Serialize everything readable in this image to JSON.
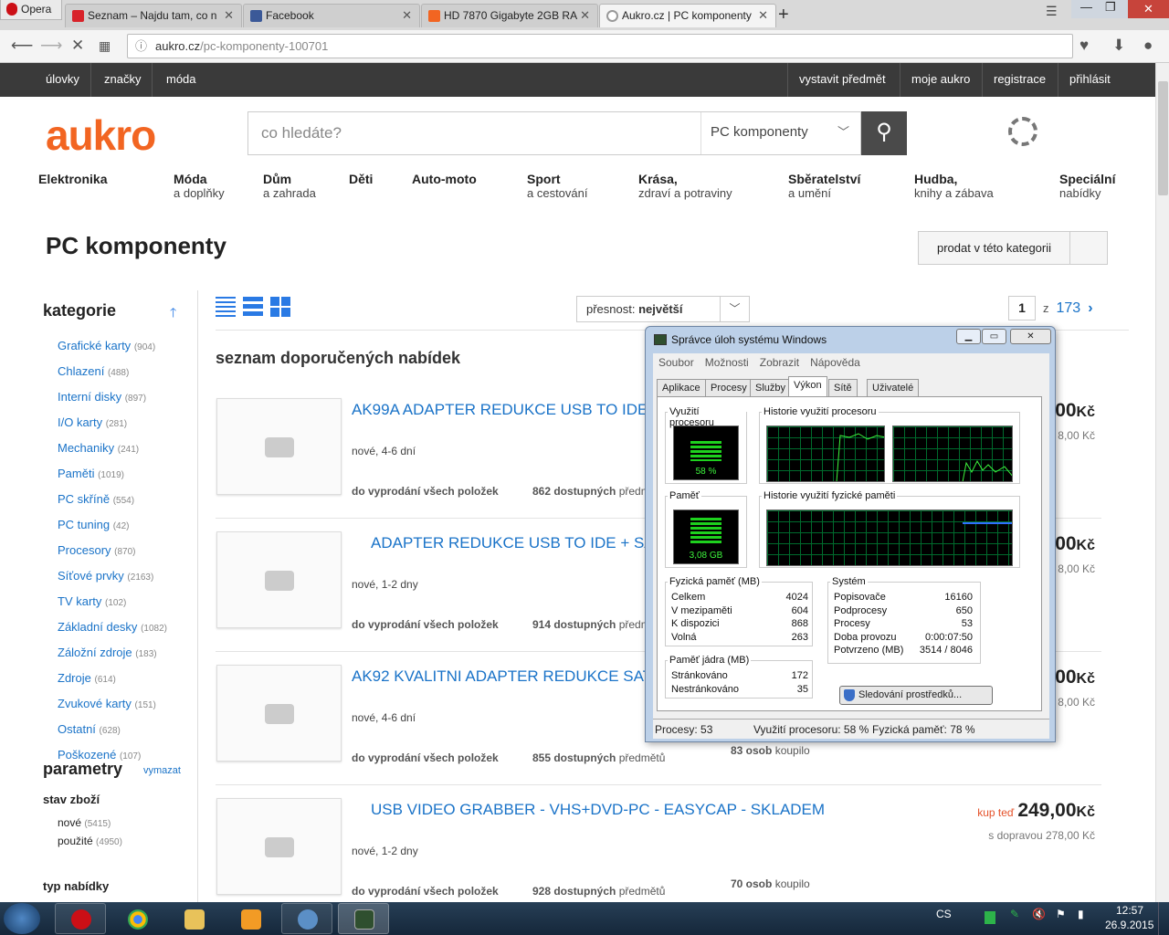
{
  "browser": {
    "menu_label": "Opera",
    "tabs": [
      {
        "label": "Seznam – Najdu tam, co n",
        "color": "#d8232a"
      },
      {
        "label": "Facebook",
        "color": "#3b5998"
      },
      {
        "label": "HD 7870 Gigabyte 2GB RA",
        "color": "#f26522"
      },
      {
        "label": "Aukro.cz | PC komponenty",
        "color": "#999999"
      }
    ],
    "url_host": "aukro.cz",
    "url_path": "/pc-komponenty-100701"
  },
  "site": {
    "topnav_left": [
      "úlovky",
      "značky",
      "móda"
    ],
    "topnav_right": [
      "vystavit předmět",
      "moje aukro",
      "registrace",
      "přihlásit"
    ],
    "logo": "aukro",
    "search_placeholder": "co hledáte?",
    "search_category": "PC komponenty",
    "categories": [
      {
        "main": "Elektronika",
        "sub": ""
      },
      {
        "main": "Móda",
        "sub": "a doplňky"
      },
      {
        "main": "Dům",
        "sub": "a zahrada"
      },
      {
        "main": "Děti",
        "sub": ""
      },
      {
        "main": "Auto-moto",
        "sub": ""
      },
      {
        "main": "Sport",
        "sub": "a cestování"
      },
      {
        "main": "Krása,",
        "sub": "zdraví a potraviny"
      },
      {
        "main": "Sběratelství",
        "sub": "a umění"
      },
      {
        "main": "Hudba,",
        "sub": "knihy a zábava"
      },
      {
        "main": "Speciální",
        "sub": "nabídky"
      }
    ],
    "page_title": "PC komponenty",
    "sell_button": "prodat v této kategorii"
  },
  "sidebar": {
    "heading": "kategorie",
    "items": [
      {
        "label": "Grafické karty",
        "count": "(904)"
      },
      {
        "label": "Chlazení",
        "count": "(488)"
      },
      {
        "label": "Interní disky",
        "count": "(897)"
      },
      {
        "label": "I/O karty",
        "count": "(281)"
      },
      {
        "label": "Mechaniky",
        "count": "(241)"
      },
      {
        "label": "Paměti",
        "count": "(1019)"
      },
      {
        "label": "PC skříně",
        "count": "(554)"
      },
      {
        "label": "PC tuning",
        "count": "(42)"
      },
      {
        "label": "Procesory",
        "count": "(870)"
      },
      {
        "label": "Síťové prvky",
        "count": "(2163)"
      },
      {
        "label": "TV karty",
        "count": "(102)"
      },
      {
        "label": "Základní desky",
        "count": "(1082)"
      },
      {
        "label": "Záložní zdroje",
        "count": "(183)"
      },
      {
        "label": "Zdroje",
        "count": "(614)"
      },
      {
        "label": "Zvukové karty",
        "count": "(151)"
      },
      {
        "label": "Ostatní",
        "count": "(628)"
      },
      {
        "label": "Poškozené",
        "count": "(107)"
      }
    ],
    "params_heading": "parametry",
    "params_clear": "vymazat",
    "state_heading": "stav zboží",
    "states": [
      {
        "label": "nové",
        "count": "(5415)"
      },
      {
        "label": "použité",
        "count": "(4950)"
      }
    ],
    "offer_type_heading": "typ nabídky"
  },
  "listing": {
    "sort_label": "přesnost:",
    "sort_value": "největší",
    "page": "1",
    "page_of": "z",
    "total_pages": "173",
    "heading": "seznam doporučených nabídek",
    "items": [
      {
        "title": "AK99A ADAPTER REDUKCE USB TO IDE +",
        "cond": "nové, 4-6 dní",
        "foot": "do vyprodání všech položek",
        "avail_n": "862 dostupných",
        "avail_t": "předm",
        "bought_n": "",
        "bought_t": "",
        "price": "00",
        "kc": "Kč",
        "ship": "8,00 Kč",
        "kup": ""
      },
      {
        "title": "ADAPTER REDUKCE USB TO IDE + SAT",
        "cond": "nové, 1-2 dny",
        "foot": "do vyprodání všech položek",
        "avail_n": "914 dostupných",
        "avail_t": "předm",
        "bought_n": "",
        "bought_t": "",
        "price": "00",
        "kc": "Kč",
        "ship": "8,00 Kč",
        "kup": ""
      },
      {
        "title": "AK92 KVALITNI ADAPTER REDUKCE SATA",
        "cond": "nové, 4-6 dní",
        "foot": "do vyprodání všech položek",
        "avail_n": "855 dostupných",
        "avail_t": "předmětů",
        "bought_n": "83 osob",
        "bought_t": "koupilo",
        "price": "00",
        "kc": "Kč",
        "ship": "8,00 Kč",
        "kup": ""
      },
      {
        "title": "USB VIDEO GRABBER - VHS+DVD-PC - EASYCAP - SKLADEM",
        "cond": "nové, 1-2 dny",
        "foot": "do vyprodání všech položek",
        "avail_n": "928 dostupných",
        "avail_t": "předmětů",
        "bought_n": "70 osob",
        "bought_t": "koupilo",
        "price": "249,00",
        "kc": "Kč",
        "ship": "s dopravou 278,00 Kč",
        "kup": "kup teď"
      }
    ]
  },
  "taskmanager": {
    "title": "Správce úloh systému Windows",
    "menu": [
      "Soubor",
      "Možnosti",
      "Zobrazit",
      "Nápověda"
    ],
    "tabs": [
      "Aplikace",
      "Procesy",
      "Služby",
      "Výkon",
      "Sítě",
      "Uživatelé"
    ],
    "cpu_label": "Využití procesoru",
    "cpu_value": "58 %",
    "cpu_fraction": 0.58,
    "cpu_history_label": "Historie využití procesoru",
    "mem_label": "Paměť",
    "mem_value": "3,08 GB",
    "mem_fraction": 0.78,
    "mem_history_label": "Historie využití fyzické paměti",
    "phys_heading": "Fyzická paměť (MB)",
    "phys": [
      {
        "k": "Celkem",
        "v": "4024"
      },
      {
        "k": "V mezipaměti",
        "v": "604"
      },
      {
        "k": "K dispozici",
        "v": "868"
      },
      {
        "k": "Volná",
        "v": "263"
      }
    ],
    "kernel_heading": "Paměť jádra (MB)",
    "kernel": [
      {
        "k": "Stránkováno",
        "v": "172"
      },
      {
        "k": "Nestránkováno",
        "v": "35"
      }
    ],
    "system_heading": "Systém",
    "system": [
      {
        "k": "Popisovače",
        "v": "16160"
      },
      {
        "k": "Podprocesy",
        "v": "650"
      },
      {
        "k": "Procesy",
        "v": "53"
      },
      {
        "k": "Doba provozu",
        "v": "0:00:07:50"
      },
      {
        "k": "Potvrzeno (MB)",
        "v": "3514 / 8046"
      }
    ],
    "monitor_button": "Sledování prostředků...",
    "status": [
      "Procesy: 53",
      "Využití procesoru: 58 %",
      "Fyzická paměť: 78 %"
    ]
  },
  "taskbar": {
    "lang": "CS",
    "time": "12:57",
    "date": "26.9.2015"
  }
}
